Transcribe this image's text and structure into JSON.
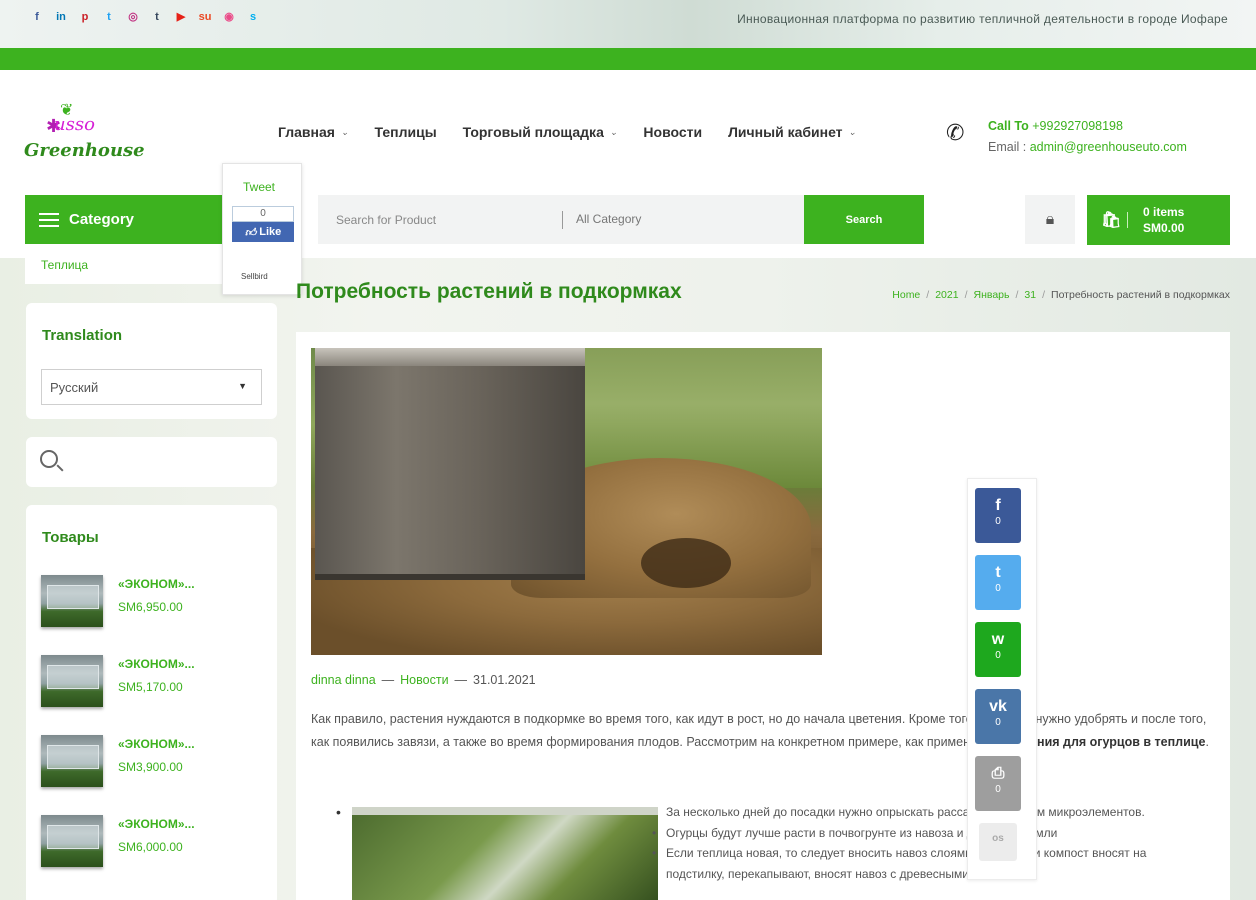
{
  "topbar": {
    "social_icons": [
      "facebook-icon",
      "linkedin-icon",
      "pinterest-icon",
      "twitter-icon",
      "instagram-icon",
      "tumblr-icon",
      "youtube-icon",
      "stumbleupon-icon",
      "dribbble-icon",
      "skype-icon"
    ],
    "tagline": "Инновационная платформа по развитию тепличной деятельности в городе Иофаре"
  },
  "header": {
    "logo_text_top": "usso",
    "logo_text_bottom": "Greenhouse",
    "nav": [
      {
        "label": "Главная",
        "has_dropdown": true
      },
      {
        "label": "Теплицы",
        "has_dropdown": false
      },
      {
        "label": "Торговый площадка",
        "has_dropdown": true
      },
      {
        "label": "Новости",
        "has_dropdown": false
      },
      {
        "label": "Личный кабинет",
        "has_dropdown": true
      }
    ],
    "call_label": "Call To",
    "phone": "+992927098198",
    "email_label": "Email :",
    "email": "admin@greenhouseuto.com"
  },
  "toolbar": {
    "category_label": "Category",
    "search_placeholder": "Search for Product",
    "category_select": "All Category",
    "search_button": "Search",
    "cart_items": "0 items",
    "cart_total": "SM0.00"
  },
  "share_popup": {
    "tweet": "Tweet",
    "like_count": "0",
    "like_label": "Like",
    "more": "Sellbird"
  },
  "sidebar": {
    "category_item": "Теплица",
    "translation_title": "Translation",
    "language_selected": "Русский",
    "products_title": "Товары",
    "products": [
      {
        "name": "«ЭКОНОМ»...",
        "price": "SM6,950.00"
      },
      {
        "name": "«ЭКОНОМ»...",
        "price": "SM5,170.00"
      },
      {
        "name": "«ЭКОНОМ»...",
        "price": "SM3,900.00"
      },
      {
        "name": "«ЭКОНОМ»...",
        "price": "SM6,000.00"
      }
    ]
  },
  "article": {
    "title": "Потребность растений в подкормках",
    "breadcrumb": [
      "Home",
      "2021",
      "Январь",
      "31",
      "Потребность растений в подкормках"
    ],
    "author": "dinna dinna",
    "category": "Новости",
    "date": "31.01.2021",
    "para_part1": "Как правило, растения нуждаются в подкормке во время того, как идут в рост, но до начала цветения. Кроме того, культуры нужно удобрять и после того, как появились завязи, а также во время формирования плодов. Рассмотрим на конкретном примере, как применять ",
    "para_bold": "удобрения для огурцов в теплице",
    "para_part2": ".",
    "list": [
      "За несколько дней до посадки нужно опрыскать рассаду раствором микроэлементов.",
      "Огурцы будут лучше расти в почвогрунте из навоза и дерновой земли",
      "Если теплица новая, то следует вносить навоз слоями – навоз или компост вносят на подстилку, перекапывают, вносят навоз с древесными"
    ]
  },
  "floating_share": [
    {
      "icon": "facebook-icon",
      "glyph": "f",
      "count": "0",
      "color": "#3b5998"
    },
    {
      "icon": "twitter-icon",
      "glyph": "t",
      "count": "0",
      "color": "#55acee"
    },
    {
      "icon": "whatsapp-icon",
      "glyph": "w",
      "count": "0",
      "color": "#1ea81e"
    },
    {
      "icon": "vk-icon",
      "glyph": "vk",
      "count": "0",
      "color": "#4a76a8"
    },
    {
      "icon": "print-icon",
      "glyph": "⎙",
      "count": "0",
      "color": "#9e9e9e"
    },
    {
      "icon": "more-share-icon",
      "glyph": "os",
      "count": "",
      "color": "#e8e8e8"
    }
  ],
  "colors": {
    "accent": "#3db21f",
    "accent_dark": "#2f8a1c"
  }
}
